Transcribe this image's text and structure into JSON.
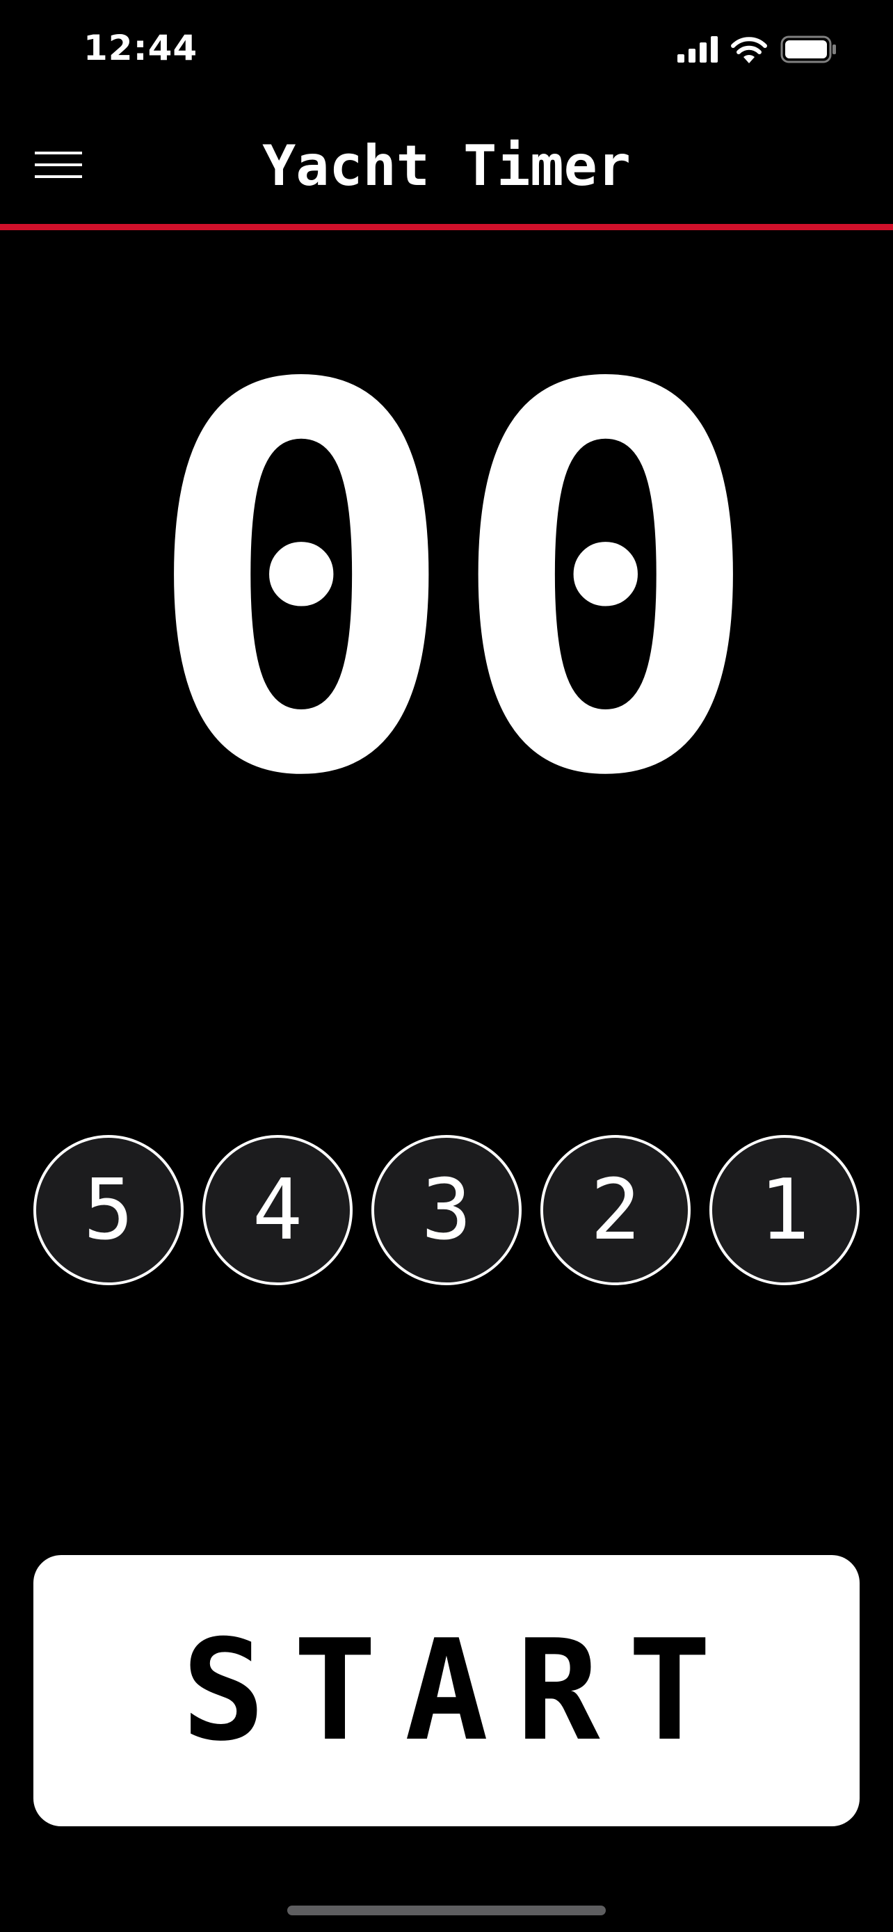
{
  "status_bar": {
    "time": "12:44",
    "icons": [
      "cellular-signal-icon",
      "wifi-icon",
      "battery-icon"
    ]
  },
  "header": {
    "menu_icon": "hamburger-menu-icon",
    "title": "Yacht Timer"
  },
  "timer": {
    "display": "00"
  },
  "presets": [
    {
      "label": "5"
    },
    {
      "label": "4"
    },
    {
      "label": "3"
    },
    {
      "label": "2"
    },
    {
      "label": "1"
    }
  ],
  "start_button": {
    "label": "START"
  },
  "colors": {
    "background": "#000000",
    "accent_line": "#d0102a",
    "preset_fill": "#1c1c1e",
    "button_fill": "#ffffff",
    "button_text": "#000000",
    "home_indicator": "#5e5e60"
  }
}
